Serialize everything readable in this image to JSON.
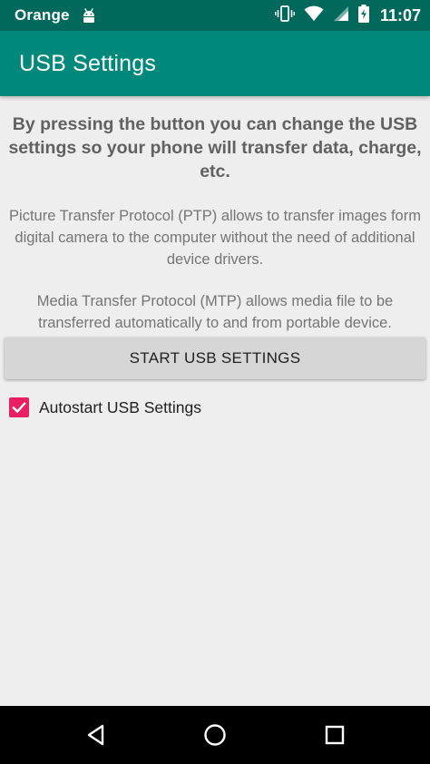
{
  "status_bar": {
    "carrier": "Orange",
    "time": "11:07",
    "icons": [
      "android-icon",
      "vibrate-icon",
      "wifi-icon",
      "cell-signal-icon",
      "battery-charging-icon"
    ],
    "background_color": "#00695c"
  },
  "app_bar": {
    "title": "USB Settings",
    "background_color": "#00897b"
  },
  "main": {
    "headline": "By pressing the button you can change the USB settings so your phone will transfer data, charge, etc.",
    "ptp_text": "Picture Transfer Protocol (PTP) allows to transfer images form digital camera to the computer without the need of additional device drivers.",
    "mtp_text": "Media Transfer Protocol (MTP) allows media file to be transferred automatically to and from portable device.",
    "start_button_label": "START USB SETTINGS",
    "autostart": {
      "label": "Autostart USB Settings",
      "checked": true,
      "accent_color": "#e91e63"
    }
  },
  "nav_bar": {
    "icons": [
      "back-icon",
      "home-icon",
      "recents-icon"
    ]
  }
}
